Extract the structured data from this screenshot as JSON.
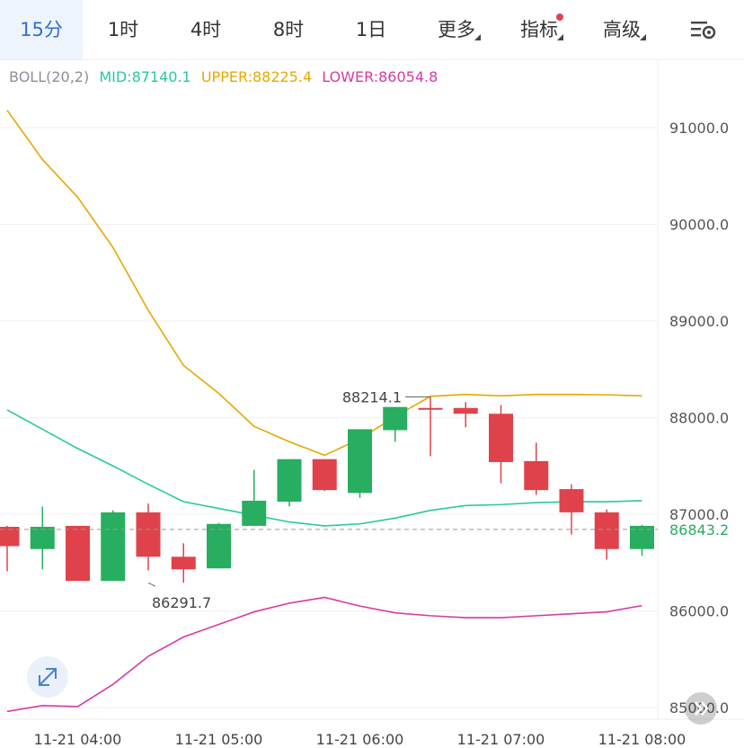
{
  "tabs": [
    {
      "label": "15分",
      "active": true
    },
    {
      "label": "1时"
    },
    {
      "label": "4时"
    },
    {
      "label": "8时"
    },
    {
      "label": "1日"
    },
    {
      "label": "更多",
      "dropdown": true
    },
    {
      "label": "指标",
      "dropdown": true,
      "badge": true
    },
    {
      "label": "高级",
      "dropdown": true
    }
  ],
  "settings_icon": "chart-settings-icon",
  "legend": {
    "name": "BOLL(20,2)",
    "mid": "MID:87140.1",
    "upper": "UPPER:88225.4",
    "lower": "LOWER:86054.8"
  },
  "colors": {
    "up": "#27ae60",
    "down": "#e0424b",
    "mid": "#28c9a0",
    "upper": "#e6a800",
    "lower": "#d63aa5",
    "accent": "#2e6fd1"
  },
  "chart_data": {
    "type": "candlestick",
    "ylim": [
      84900,
      91600
    ],
    "y_ticks": [
      "91000.0",
      "90000.0",
      "89000.0",
      "88000.0",
      "87000.0",
      "86000.0",
      "85000.0"
    ],
    "x_ticks": [
      "11-21 04:00",
      "11-21 05:00",
      "11-21 06:00",
      "11-21 07:00",
      "11-21 08:00"
    ],
    "current_price": "86843.2",
    "current_value": 86843.2,
    "annotations": [
      {
        "text": "88214.1",
        "value": 88214.1,
        "candle": 12
      },
      {
        "text": "86291.7",
        "value": 86291.7,
        "candle": 4
      }
    ],
    "candles": [
      {
        "o": 86870,
        "h": 86880,
        "l": 86410,
        "c": 86670
      },
      {
        "o": 86640,
        "h": 87080,
        "l": 86430,
        "c": 86870
      },
      {
        "o": 86880,
        "h": 86880,
        "l": 86310,
        "c": 86310
      },
      {
        "o": 86310,
        "h": 87040,
        "l": 86310,
        "c": 87020
      },
      {
        "o": 87020,
        "h": 87110,
        "l": 86420,
        "c": 86560
      },
      {
        "o": 86560,
        "h": 86700,
        "l": 86291.7,
        "c": 86430
      },
      {
        "o": 86440,
        "h": 86910,
        "l": 86440,
        "c": 86900
      },
      {
        "o": 86880,
        "h": 87460,
        "l": 86880,
        "c": 87140
      },
      {
        "o": 87130,
        "h": 87570,
        "l": 87080,
        "c": 87570
      },
      {
        "o": 87570,
        "h": 87570,
        "l": 87240,
        "c": 87250
      },
      {
        "o": 87220,
        "h": 87880,
        "l": 87170,
        "c": 87880
      },
      {
        "o": 87870,
        "h": 88100,
        "l": 87750,
        "c": 88110
      },
      {
        "o": 88100,
        "h": 88214.1,
        "l": 87600,
        "c": 88090
      },
      {
        "o": 88100,
        "h": 88160,
        "l": 87900,
        "c": 88040
      },
      {
        "o": 88040,
        "h": 88130,
        "l": 87320,
        "c": 87540
      },
      {
        "o": 87550,
        "h": 87740,
        "l": 87200,
        "c": 87250
      },
      {
        "o": 87260,
        "h": 87310,
        "l": 86790,
        "c": 87020
      },
      {
        "o": 87020,
        "h": 87050,
        "l": 86530,
        "c": 86640
      },
      {
        "o": 86640,
        "h": 86890,
        "l": 86570,
        "c": 86880
      }
    ],
    "series": [
      {
        "name": "UPPER",
        "values": [
          91180,
          90670,
          90280,
          89760,
          89110,
          88540,
          88250,
          87910,
          87750,
          87610,
          87780,
          88010,
          88220,
          88240,
          88225,
          88240,
          88240,
          88236,
          88225.4
        ]
      },
      {
        "name": "MID",
        "values": [
          88080,
          87880,
          87680,
          87500,
          87310,
          87130,
          87060,
          86990,
          86920,
          86880,
          86900,
          86960,
          87040,
          87090,
          87100,
          87120,
          87130,
          87130,
          87140.1
        ]
      },
      {
        "name": "LOWER",
        "values": [
          84960,
          85020,
          85010,
          85240,
          85530,
          85730,
          85860,
          85990,
          86080,
          86140,
          86050,
          85980,
          85950,
          85930,
          85930,
          85950,
          85970,
          85990,
          86054.8
        ]
      }
    ]
  }
}
